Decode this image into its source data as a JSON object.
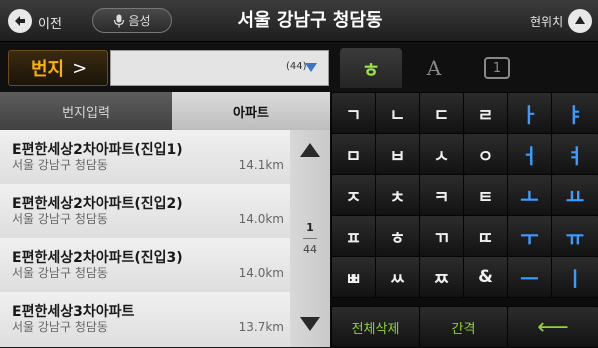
{
  "topbar": {
    "back_label": "이전",
    "voice_label": "음성",
    "title": "서울 강남구 청담동",
    "location_label": "현위치"
  },
  "search": {
    "addr_mode_label": "번지",
    "input_value": "",
    "result_count": "(44)"
  },
  "input_modes": {
    "korean": "ㅎ",
    "english": "A",
    "number": "1"
  },
  "segment": {
    "lot_input": "번지입력",
    "apartment": "아파트",
    "selected": "아파트"
  },
  "results": [
    {
      "name": "E편한세상2차아파트(진입1)",
      "address": "서울 강남구 청담동",
      "distance": "14.1km"
    },
    {
      "name": "E편한세상2차아파트(진입2)",
      "address": "서울 강남구 청담동",
      "distance": "14.0km"
    },
    {
      "name": "E편한세상2차아파트(진입3)",
      "address": "서울 강남구 청담동",
      "distance": "14.0km"
    },
    {
      "name": "E편한세상3차아파트",
      "address": "서울 강남구 청담동",
      "distance": "13.7km"
    }
  ],
  "pager": {
    "current": "1",
    "total": "44"
  },
  "keyboard": {
    "rows": [
      [
        "ㄱ",
        "ㄴ",
        "ㄷ",
        "ㄹ",
        "ㅏ",
        "ㅑ"
      ],
      [
        "ㅁ",
        "ㅂ",
        "ㅅ",
        "ㅇ",
        "ㅓ",
        "ㅕ"
      ],
      [
        "ㅈ",
        "ㅊ",
        "ㅋ",
        "ㅌ",
        "ㅗ",
        "ㅛ"
      ],
      [
        "ㅍ",
        "ㅎ",
        "ㄲ",
        "ㄸ",
        "ㅜ",
        "ㅠ"
      ],
      [
        "ㅃ",
        "ㅆ",
        "ㅉ",
        "&",
        "ㅡ",
        "ㅣ"
      ]
    ],
    "clear_all": "전체삭제",
    "space": "간격",
    "backspace": "⟵"
  },
  "colors": {
    "accent_orange": "#ffb200",
    "key_green": "#8fd13a",
    "vowel_blue": "#3d9bff"
  }
}
